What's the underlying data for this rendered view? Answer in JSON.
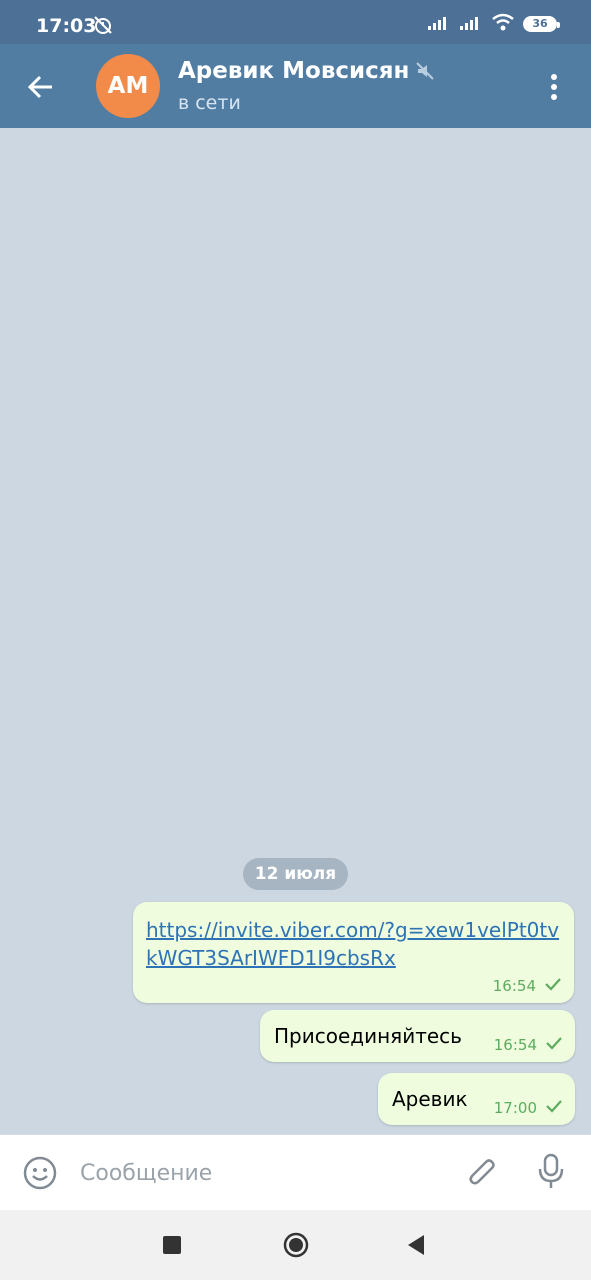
{
  "status_bar": {
    "time": "17:03",
    "battery": "36",
    "icons": [
      "alarm-off-icon",
      "signal-icon",
      "wifi-icon",
      "battery-icon"
    ]
  },
  "header": {
    "avatar_initials": "AM",
    "avatar_color": "#f28b49",
    "contact_name": "Аревик Мовсисян",
    "status": "в сети",
    "bar_color": "#527da3"
  },
  "chat": {
    "date_label": "12 июля",
    "messages": [
      {
        "text": "https://invite.viber.com/?g=xew1velPt0tvkWGT3SArIWFD1I9cbsRx",
        "time": "16:54",
        "is_link": true
      },
      {
        "text": "Присоединяйтесь",
        "time": "16:54",
        "is_link": false
      },
      {
        "text": "Аревик",
        "time": "17:00",
        "is_link": false
      }
    ]
  },
  "composer": {
    "placeholder": "Сообщение"
  }
}
